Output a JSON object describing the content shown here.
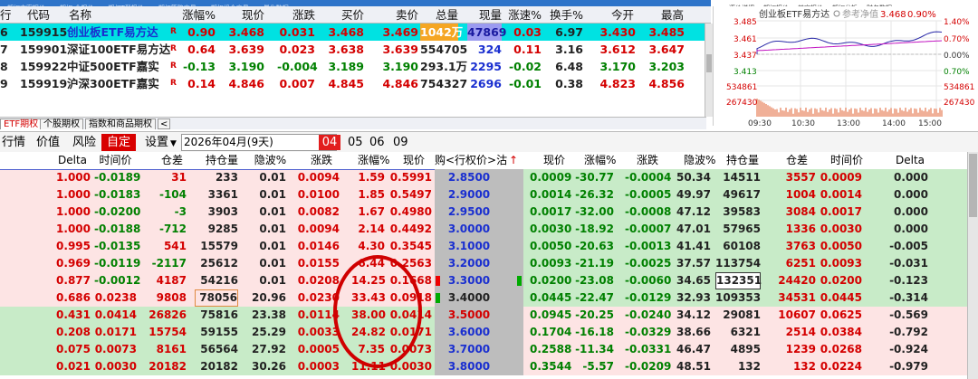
{
  "top_tabs": [
    "期权方案报价",
    "期权-全报价",
    "期权T型报价",
    "期权策略交易",
    "期权组合交易",
    "量化数据"
  ],
  "right_tabs": [
    "逐价详细",
    "期权报价",
    "其它报价",
    "期权分析",
    "财务数据"
  ],
  "quote_header": {
    "code": "代码",
    "name": "名称",
    "chg_pct": "涨幅%",
    "price": "现价",
    "chg": "涨跌",
    "bid": "买价",
    "ask": "卖价",
    "vol": "总量",
    "cur": "现量",
    "speed": "涨速%",
    "turnover": "换手%",
    "open": "今开",
    "high": "最高"
  },
  "quotes": [
    {
      "idx": "6",
      "code": "159915",
      "name": "创业板ETF易方达",
      "flag": "R",
      "chg_pct": "0.90",
      "price": "3.468",
      "chg": "0.031",
      "bid": "3.468",
      "ask": "3.469",
      "vol": "1042万",
      "cur": "47869",
      "speed": "0.03",
      "turnover": "6.97",
      "open": "3.430",
      "high": "3.485"
    },
    {
      "idx": "7",
      "code": "159901",
      "name": "深证100ETF易方达",
      "flag": "R",
      "chg_pct": "0.64",
      "price": "3.639",
      "chg": "0.023",
      "bid": "3.638",
      "ask": "3.639",
      "vol": "554705",
      "cur": "324",
      "speed": "0.11",
      "turnover": "3.16",
      "open": "3.612",
      "high": "3.647"
    },
    {
      "idx": "8",
      "code": "159922",
      "name": "中证500ETF嘉实",
      "flag": "R",
      "chg_pct": "-0.13",
      "price": "3.190",
      "chg": "-0.004",
      "bid": "3.189",
      "ask": "3.190",
      "vol": "293.1万",
      "cur": "2295",
      "speed": "-0.02",
      "turnover": "6.48",
      "open": "3.170",
      "high": "3.203"
    },
    {
      "idx": "9",
      "code": "159919",
      "name": "沪深300ETF嘉实",
      "flag": "R",
      "chg_pct": "0.14",
      "price": "4.846",
      "chg": "0.007",
      "bid": "4.845",
      "ask": "4.846",
      "vol": "754327",
      "cur": "2696",
      "speed": "-0.01",
      "turnover": "0.38",
      "open": "4.823",
      "high": "4.856"
    }
  ],
  "mini_chart": {
    "title": "创业板ETF易方达",
    "legend": "参考净值",
    "last": "3.468",
    "last_pct": "0.90%",
    "y_left": [
      "3.485",
      "3.461",
      "3.437",
      "3.413"
    ],
    "y_right": [
      "1.40%",
      "0.70%",
      "0.00%",
      "0.70%"
    ],
    "vol_left": [
      "534861",
      "267430"
    ],
    "vol_right": [
      "534861",
      "267430"
    ],
    "x_ticks": [
      "09:30",
      "10:30",
      "13:00",
      "14:00",
      "15:00"
    ]
  },
  "sub_tabs": [
    "ETF期权",
    "个股期权",
    "指数和商品期权"
  ],
  "toolbar": {
    "quote": "行情",
    "price": "价值",
    "risk": "风险",
    "custom": "自定",
    "settings": "设置",
    "settings_arrow": "▼",
    "date": "2026年04月(9天)",
    "date_arrow": "▼",
    "months": [
      "04",
      "05",
      "06",
      "09"
    ]
  },
  "option_header": {
    "delta": "Delta",
    "time_value": "时间价",
    "oi_chg": "仓差",
    "oi": "持仓量",
    "iv": "隐波%",
    "chg": "涨跌",
    "chg_pct": "涨幅%",
    "price": "现价",
    "strike": "购<行权价>沽",
    "up_arrow": "↑"
  },
  "option_rows": [
    {
      "cd": "1.000",
      "ct": "-0.0189",
      "co": "31",
      "cp": "233",
      "civ": "0.01",
      "cc": "0.0094",
      "cpct": "1.59",
      "cpx": "0.5991",
      "k": "2.8500",
      "pp": "0.0009",
      "ppct": "-30.77",
      "pc": "-0.0004",
      "piv": "50.34",
      "pop": "14511",
      "poc": "3557",
      "pt": "0.0009",
      "pd": "0.000"
    },
    {
      "cd": "1.000",
      "ct": "-0.0183",
      "co": "-104",
      "cp": "3361",
      "civ": "0.01",
      "cc": "0.0100",
      "cpct": "1.85",
      "cpx": "0.5497",
      "k": "2.9000",
      "pp": "0.0014",
      "ppct": "-26.32",
      "pc": "-0.0005",
      "piv": "49.97",
      "pop": "49617",
      "poc": "1004",
      "pt": "0.0014",
      "pd": "0.000"
    },
    {
      "cd": "1.000",
      "ct": "-0.0200",
      "co": "-3",
      "cp": "3903",
      "civ": "0.01",
      "cc": "0.0082",
      "cpct": "1.67",
      "cpx": "0.4980",
      "k": "2.9500",
      "pp": "0.0017",
      "ppct": "-32.00",
      "pc": "-0.0008",
      "piv": "47.12",
      "pop": "39583",
      "poc": "3084",
      "pt": "0.0017",
      "pd": "0.000"
    },
    {
      "cd": "1.000",
      "ct": "-0.0188",
      "co": "-712",
      "cp": "9285",
      "civ": "0.01",
      "cc": "0.0094",
      "cpct": "2.14",
      "cpx": "0.4492",
      "k": "3.0000",
      "pp": "0.0030",
      "ppct": "-18.92",
      "pc": "-0.0007",
      "piv": "47.01",
      "pop": "57965",
      "poc": "1336",
      "pt": "0.0030",
      "pd": "0.000"
    },
    {
      "cd": "0.995",
      "ct": "-0.0135",
      "co": "541",
      "cp": "15579",
      "civ": "0.01",
      "cc": "0.0146",
      "cpct": "4.30",
      "cpx": "0.3545",
      "k": "3.1000",
      "pp": "0.0050",
      "ppct": "-20.63",
      "pc": "-0.0013",
      "piv": "41.41",
      "pop": "60108",
      "poc": "3763",
      "pt": "0.0050",
      "pd": "-0.005"
    },
    {
      "cd": "0.969",
      "ct": "-0.0119",
      "co": "-2117",
      "cp": "25612",
      "civ": "0.01",
      "cc": "0.0155",
      "cpct": "6.44",
      "cpx": "0.2563",
      "k": "3.2000",
      "pp": "0.0093",
      "ppct": "-21.19",
      "pc": "-0.0025",
      "piv": "37.57",
      "pop": "113754",
      "poc": "6251",
      "pt": "0.0093",
      "pd": "-0.031"
    },
    {
      "cd": "0.877",
      "ct": "-0.0012",
      "co": "4187",
      "cp": "54216",
      "civ": "0.01",
      "cc": "0.0208",
      "cpct": "14.25",
      "cpx": "0.1668",
      "k": "3.3000",
      "pp": "0.0200",
      "ppct": "-23.08",
      "pc": "-0.0060",
      "piv": "34.65",
      "pop": "132351",
      "poc": "24420",
      "pt": "0.0200",
      "pd": "-0.123"
    },
    {
      "cd": "0.686",
      "ct": "0.0238",
      "co": "9808",
      "cp": "78056",
      "civ": "20.96",
      "cc": "0.0230",
      "cpct": "33.43",
      "cpx": "0.0918",
      "k": "3.4000",
      "pp": "0.0445",
      "ppct": "-22.47",
      "pc": "-0.0129",
      "piv": "32.93",
      "pop": "109353",
      "poc": "34531",
      "pt": "0.0445",
      "pd": "-0.314"
    },
    {
      "cd": "0.431",
      "ct": "0.0414",
      "co": "26826",
      "cp": "75816",
      "civ": "23.38",
      "cc": "0.0114",
      "cpct": "38.00",
      "cpx": "0.0414",
      "k": "3.5000",
      "pp": "0.0945",
      "ppct": "-20.25",
      "pc": "-0.0240",
      "piv": "34.12",
      "pop": "29081",
      "poc": "10607",
      "pt": "0.0625",
      "pd": "-0.569"
    },
    {
      "cd": "0.208",
      "ct": "0.0171",
      "co": "15754",
      "cp": "59155",
      "civ": "25.29",
      "cc": "0.0033",
      "cpct": "24.82",
      "cpx": "0.0171",
      "k": "3.6000",
      "pp": "0.1704",
      "ppct": "-16.18",
      "pc": "-0.0329",
      "piv": "38.66",
      "pop": "6321",
      "poc": "2514",
      "pt": "0.0384",
      "pd": "-0.792"
    },
    {
      "cd": "0.075",
      "ct": "0.0073",
      "co": "8161",
      "cp": "56564",
      "civ": "27.92",
      "cc": "0.0005",
      "cpct": "7.35",
      "cpx": "0.0073",
      "k": "3.7000",
      "pp": "0.2588",
      "ppct": "-11.34",
      "pc": "-0.0331",
      "piv": "46.47",
      "pop": "4895",
      "poc": "1239",
      "pt": "0.0268",
      "pd": "-0.924"
    },
    {
      "cd": "0.021",
      "ct": "0.0030",
      "co": "20182",
      "cp": "20182",
      "civ": "30.26",
      "cc": "0.0003",
      "cpct": "11.11",
      "cpx": "0.0030",
      "k": "3.8000",
      "pp": "0.3544",
      "ppct": "-5.57",
      "pc": "-0.0209",
      "piv": "48.51",
      "pop": "132",
      "poc": "132",
      "pt": "0.0224",
      "pd": "-0.979"
    }
  ],
  "colors": {
    "accent_red": "#d40000",
    "call_bg": "#fde4e4",
    "put_bg": "#c8ebc8",
    "selected_row": "#00e2e2",
    "annotation": "#d00000"
  }
}
